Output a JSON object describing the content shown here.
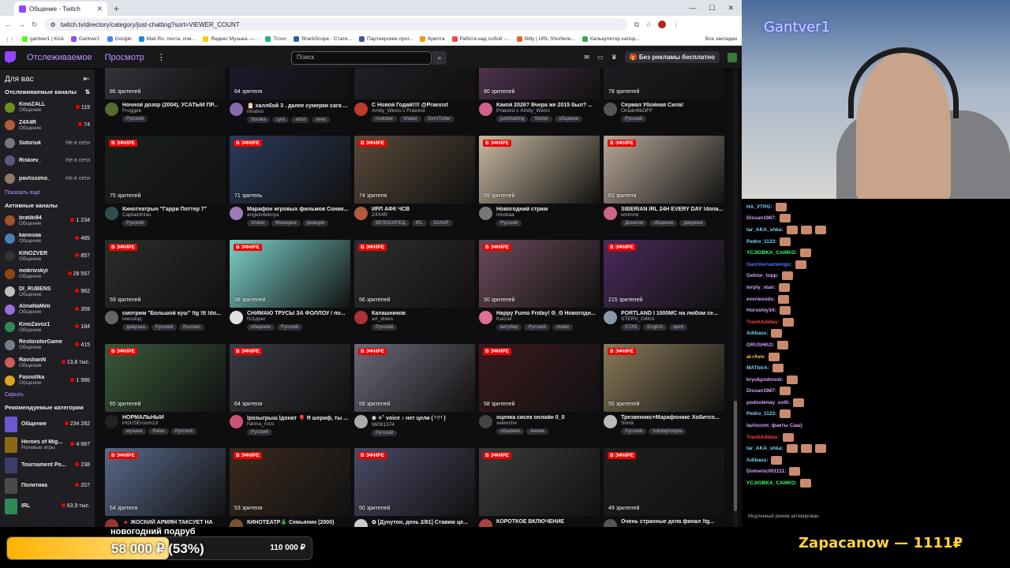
{
  "browser": {
    "tab_title": "Общение - Twitch",
    "url": "twitch.tv/directory/category/just-chatting?sort=VIEWER_COUNT",
    "bookmarks": [
      "gantver1 | Kick",
      "Gantver1",
      "Google",
      "Mail.Ru: почта, пои...",
      "Яндекс Музыка —...",
      "Trovo",
      "SharkScope - Стати...",
      "Партнерские прог...",
      "Крипта",
      "Работа над собой -...",
      "Bitly | URL Shortene...",
      "Калькулятор калор..."
    ],
    "all_bookmarks": "Все закладки"
  },
  "nav": {
    "following": "Отслеживаемое",
    "browse": "Просмотр",
    "search_placeholder": "Поиск",
    "adfree": "Без рекламы бесплатно"
  },
  "sidebar": {
    "for_you": "Для вас",
    "followed_header": "Отслеживаемые каналы",
    "followed": [
      {
        "name": "KinoZALL",
        "cat": "Общение",
        "viewers": "119",
        "color": "#6b8e23"
      },
      {
        "name": "Z4X4R",
        "cat": "Общение",
        "viewers": "74",
        "color": "#b55a3c"
      },
      {
        "name": "Sidoriuk",
        "cat": "",
        "viewers": "Не в сети",
        "color": "#777"
      },
      {
        "name": "Riskiev_",
        "cat": "",
        "viewers": "Не в сети",
        "color": "#5a5a80"
      },
      {
        "name": "pavlissimo_",
        "cat": "",
        "viewers": "Не в сети",
        "color": "#8a7a66"
      }
    ],
    "show_more": "Показать еще",
    "active_header": "Активные каналы",
    "active": [
      {
        "name": "bratiki94",
        "cat": "Общение",
        "viewers": "1 234",
        "color": "#a0522d"
      },
      {
        "name": "kanoxaa",
        "cat": "Общение",
        "viewers": "485",
        "color": "#4682b4"
      },
      {
        "name": "KINOZVER",
        "cat": "Общение",
        "viewers": "857",
        "color": "#333"
      },
      {
        "name": "mokrivskyi",
        "cat": "Общение",
        "viewers": "28 567",
        "color": "#8b4513"
      },
      {
        "name": "DI_RUBENS",
        "cat": "Общение",
        "viewers": "962",
        "color": "#c0c0c0"
      },
      {
        "name": "AlinaNaMeli",
        "cat": "Общение",
        "viewers": "359",
        "color": "#9370db"
      },
      {
        "name": "KinoZavoz1",
        "cat": "Общение",
        "viewers": "184",
        "color": "#2e8b57"
      },
      {
        "name": "RestoratorGame",
        "cat": "Общение",
        "viewers": "415",
        "color": "#708090"
      },
      {
        "name": "RavshanN",
        "cat": "Общение",
        "viewers": "13,8 тыс.",
        "color": "#cd5c5c"
      },
      {
        "name": "Fasoollka",
        "cat": "Общение",
        "viewers": "1 986",
        "color": "#daa520"
      }
    ],
    "hide": "Скрыть",
    "rec_header": "Рекомендуемые категории",
    "categories": [
      {
        "name": "Общение",
        "sub": "",
        "viewers": "234 282",
        "color": "#6a5acd"
      },
      {
        "name": "Heroes of Mig...",
        "sub": "Ролевые игры",
        "viewers": "4 987",
        "color": "#8b6914"
      },
      {
        "name": "Tournament Po...",
        "sub": "",
        "viewers": "238",
        "color": "#3d3d6b"
      },
      {
        "name": "Политика",
        "sub": "",
        "viewers": "207",
        "color": "#4a4a4a"
      },
      {
        "name": "IRL",
        "sub": "",
        "viewers": "53,9 тыс.",
        "color": "#2e8b57"
      }
    ]
  },
  "live_label": "В ЭФИРЕ",
  "streams": [
    {
      "viewers": "86 зрителей",
      "title": "Ночной дозор (2004), УСАТЫЙ ПР...",
      "channel": "Froggee",
      "tags": [
        "Русский"
      ],
      "live": false,
      "bg": "#3a3a44",
      "av": "#556b2f"
    },
    {
      "viewers": "84 зрителя",
      "title": "🎅 халлбой 3 . далее сумерки сага ...",
      "channel": "innaloo",
      "tags": [
        "Soraka",
        "zyra",
        "artist",
        "кино"
      ],
      "live": false,
      "bg": "#1c1c30",
      "av": "#8866aa"
    },
    {
      "viewers": "",
      "title": "С Новой Годай!!!! @Praexist",
      "channel": "Amity_Weiss с Praexist",
      "tags": [
        "ruvtuber",
        "Vtuber",
        "GerVTuber"
      ],
      "live": false,
      "bg": "#22222a",
      "av": "#c0392b"
    },
    {
      "viewers": "80 зрителей",
      "title": "Какой 2026? Вчера же 2015 был? ...",
      "channel": "Praexist с Amity_Weiss",
      "tags": [
        "justchatting",
        "Vtuber",
        "общение"
      ],
      "live": false,
      "bg": "#5a3a5a",
      "av": "#d35f8f"
    },
    {
      "viewers": "78 зрителей",
      "title": "Сериал Убойная Сила!",
      "channel": "Onlain4ikOFF",
      "tags": [
        "Русский"
      ],
      "live": false,
      "bg": "#1e1e24",
      "av": "#555"
    },
    {
      "viewers": "75 зрителей",
      "title": "Кинотеатрыч \"Гарри Поттер 7\"",
      "channel": "CaptainKilas",
      "tags": [
        "Русский"
      ],
      "live": true,
      "bg": "#1a1f1c",
      "av": "#2f4f4f"
    },
    {
      "viewers": "71 зритель",
      "title": "Марафон игровых фильмов Соник...",
      "channel": "angelo4eknya",
      "tags": [
        "Vtuber",
        "Женщина",
        "реакция"
      ],
      "live": true,
      "bg": "#2b3a5a",
      "av": "#9b7bb8"
    },
    {
      "viewers": "74 зрителя",
      "title": "ИРЛ АФК ЧСВ",
      "channel": "Z4X4R",
      "tags": [
        "ВЕЛОСИПЕД",
        "IRL",
        "ЗАХАР"
      ],
      "live": true,
      "bg": "#5a4a3a",
      "av": "#b55a3c"
    },
    {
      "viewers": "69 зрителей",
      "title": "Новогодний стрим",
      "channel": "mkokaa",
      "tags": [
        "Русский"
      ],
      "live": true,
      "bg": "#c9b9a0",
      "av": "#777"
    },
    {
      "viewers": "63 зрителя",
      "title": "SIBERIAN IRL 24H EVERY DAY !dona...",
      "channel": "wmmrw",
      "tags": [
        "Донатон",
        "общение",
        "девушка"
      ],
      "live": true,
      "bg": "#b8a89a",
      "av": "#cc6688"
    },
    {
      "viewers": "59 зрителей",
      "title": "смотрим \"Большой куш\" !tg !tt !do...",
      "channel": "reessiqq",
      "tags": [
        "девушка",
        "Русский",
        "Russian"
      ],
      "live": true,
      "bg": "#2a2e2a",
      "av": "#666"
    },
    {
      "viewers": "58 зрителей",
      "title": "СНИМАЮ ТРУСЫ ЗА ФОЛЛОУ / по...",
      "channel": "f1l1pper",
      "tags": [
        "общение",
        "Русский"
      ],
      "live": true,
      "bg": "#7ad0c8",
      "av": "#e0e0e0"
    },
    {
      "viewers": "56 зрителей",
      "title": "Калашников",
      "channel": "art_dotes",
      "tags": [
        "Русский"
      ],
      "live": true,
      "bg": "#2e2e2e",
      "av": "#aa3333"
    },
    {
      "viewers": "50 зрителей",
      "title": "Happy Fumo Friday! ʘ_ʘ Новогодн...",
      "channel": "Kaccel",
      "tags": [
        "витубер",
        "Русский",
        "vtuber"
      ],
      "live": true,
      "bg": "#6a4a5a",
      "av": "#e07090"
    },
    {
      "viewers": "215 зрителей",
      "title": "PORTLAND I 1000MC на любом се...",
      "channel": "STERV_O4KA",
      "tags": [
        "GTA5",
        "English",
        "sport"
      ],
      "live": true,
      "bg": "#4a2a5a",
      "av": "#8899aa"
    },
    {
      "viewers": "65 зрителей",
      "title": "НОРМАЛЬНЫЙ",
      "channel": "HOUSEroom13",
      "tags": [
        "музыка",
        "Relax",
        "Русский"
      ],
      "live": true,
      "bg": "#3a5a3a",
      "av": "#222"
    },
    {
      "viewers": "64 зрителя",
      "title": "lрозыгрыш lдонат 🎈 Я шериф, ты ...",
      "channel": "hanna_ross",
      "tags": [
        "Русский"
      ],
      "live": true,
      "bg": "#3a3a44",
      "av": "#cc5577"
    },
    {
      "viewers": "59 зрителей",
      "title": "❀ ✧˚ voice ♪ нет цели ( ᵗ⌔ᵗ )",
      "channel": "96081374",
      "tags": [
        "Русский"
      ],
      "live": true,
      "bg": "#6a6a7a",
      "av": "#aaaaaa"
    },
    {
      "viewers": "58 зрителей",
      "title": "оценка сисек онлайн 0_0",
      "channel": "selenche",
      "tags": [
        "общение",
        "Аниме"
      ],
      "live": true,
      "bg": "#3a1a1e",
      "av": "#444"
    },
    {
      "viewers": "55 зрителей",
      "title": "Трезвеникс+Марафоникс Хобитсо...",
      "channel": "Sonix",
      "tags": [
        "Русский",
        "holidayhoopla"
      ],
      "live": true,
      "bg": "#8a7a5a",
      "av": "#bbb"
    },
    {
      "viewers": "54 зрителя",
      "title": "🔺 ЖОСКИЙ АРМЯН ТАКСУЕТ НА",
      "channel": "",
      "tags": [],
      "live": true,
      "bg": "#5a6a8a",
      "av": "#993333"
    },
    {
      "viewers": "53 зрителя",
      "title": "КИНОТЕАТР🎄 Семьянин (2000)",
      "channel": "",
      "tags": [],
      "live": true,
      "bg": "#3a2a1e",
      "av": "#775533"
    },
    {
      "viewers": "50 зрителей",
      "title": "✿ [Дунутон, день 2/81] Ставим це...",
      "channel": "",
      "tags": [],
      "live": true,
      "bg": "#4a4a66",
      "av": "#ccc"
    },
    {
      "viewers": "",
      "title": "КОРОТКОЕ ВКЛЮЧЕНИЕ",
      "channel": "",
      "tags": [],
      "live": true,
      "bg": "#3a3a3a",
      "av": "#aa4444"
    },
    {
      "viewers": "49 зрителей",
      "title": "Очень странные дела финал !tg...",
      "channel": "",
      "tags": [],
      "live": true,
      "bg": "#1e1e1e",
      "av": "#555"
    }
  ],
  "overlay": {
    "cam_name": "Gantver1",
    "goal_title": "новогодний подруб",
    "goal_current": "58 000 ₽ (53%)",
    "goal_target": "110 000 ₽",
    "goal_fraction": 0.53,
    "donor": "Zapacanow — 1111₽"
  },
  "chat": [
    {
      "user": "НА_УТРО:",
      "color": "#7bd3ff",
      "emotes": 1
    },
    {
      "user": "Dissan1987:",
      "color": "#d8a0ff",
      "emotes": 1
    },
    {
      "user": "tar_AKA_shka:",
      "color": "#7bd3ff",
      "emotes": 3
    },
    {
      "user": "Pedro_1123:",
      "color": "#7bd3ff",
      "emotes": 1
    },
    {
      "user": "YCJIOBKA_CAIIIKO:",
      "color": "#39ff6a",
      "emotes": 1
    },
    {
      "user": "GantVernadskogo:",
      "color": "#4a78ff",
      "emotes": 1
    },
    {
      "user": "Gektor_topp:",
      "color": "#d8a0ff",
      "emotes": 1
    },
    {
      "user": "terply_stan:",
      "color": "#d8a0ff",
      "emotes": 1
    },
    {
      "user": "everwoods:",
      "color": "#d8a0ff",
      "emotes": 1
    },
    {
      "user": "Horoshiy34:",
      "color": "#d8a0ff",
      "emotes": 1
    },
    {
      "user": "TrentiAdidas:",
      "color": "#ff4040",
      "emotes": 1
    },
    {
      "user": "Adibass:",
      "color": "#7bd3ff",
      "emotes": 1
    },
    {
      "user": "GRUSHKO:",
      "color": "#d8a0ff",
      "emotes": 1
    },
    {
      "user": "al.rAvo:",
      "color": "#ffd43a",
      "emotes": 1
    },
    {
      "user": "MATbirA:",
      "color": "#7bd3ff",
      "emotes": 1
    },
    {
      "user": "kryukpodonok:",
      "color": "#d8a0ff",
      "emotes": 1
    },
    {
      "user": "Dissan1987:",
      "color": "#d8a0ff",
      "emotes": 1
    },
    {
      "user": "podsolenay_solit:",
      "color": "#d8a0ff",
      "emotes": 1
    },
    {
      "user": "Pedro_1123:",
      "color": "#7bd3ff",
      "emotes": 1
    },
    {
      "user": "lazlocom: факты Саш)",
      "color": "#d8a0ff",
      "emotes": 0
    },
    {
      "user": "TrentiAdidas:",
      "color": "#ff4040",
      "emotes": 1
    },
    {
      "user": "tar_AKA_shka:",
      "color": "#7bd3ff",
      "emotes": 3
    },
    {
      "user": "Adibass:",
      "color": "#7bd3ff",
      "emotes": 1
    },
    {
      "user": "Domenic001111:",
      "color": "#d8a0ff",
      "emotes": 1
    },
    {
      "user": "YCJIOBKA_CAIIIKO:",
      "color": "#39ff6a",
      "emotes": 1
    }
  ],
  "chat_status": "Медленный режим активирован"
}
